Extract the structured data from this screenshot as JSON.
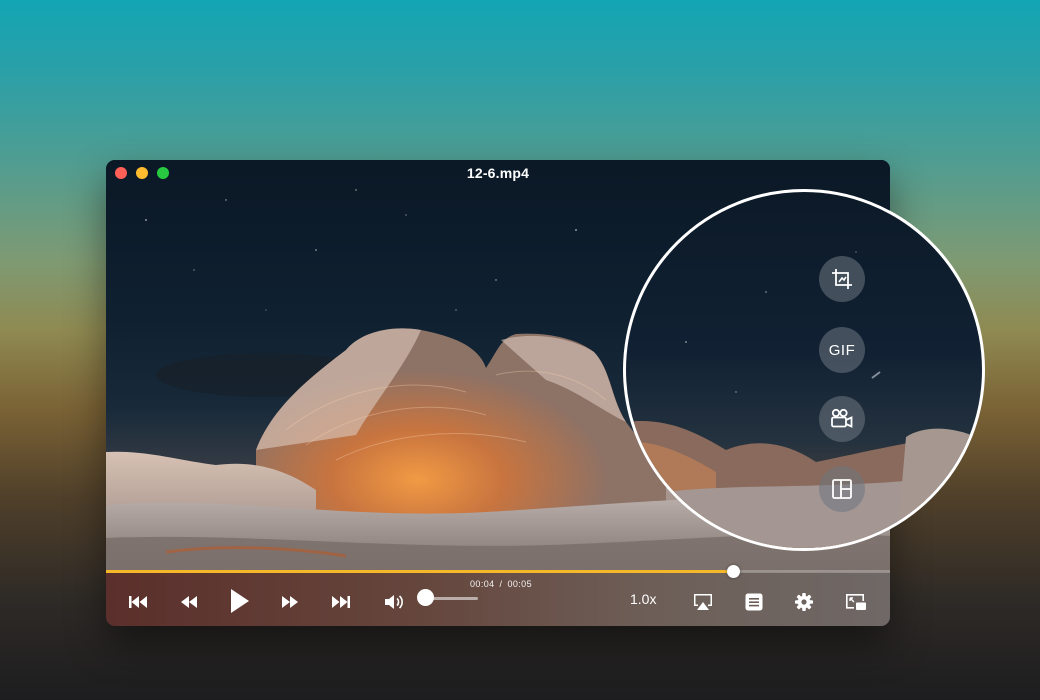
{
  "window": {
    "title": "12-6.mp4"
  },
  "player": {
    "progress_fraction": 0.8,
    "time_current": "00:04",
    "time_separator": "/",
    "time_total": "00:05",
    "volume_fraction": 0.05,
    "speed_label": "1.0x",
    "accent_color": "#f5b82a"
  },
  "controls": {
    "buttons": [
      "skip-previous-icon",
      "rewind-icon",
      "play-icon",
      "fast-forward-icon",
      "skip-next-icon",
      "volume-icon",
      "airplay-icon",
      "playlist-icon",
      "settings-icon",
      "picture-in-picture-icon"
    ]
  },
  "magnifier": {
    "buttons": [
      "crop-icon",
      "gif-button",
      "video-record-icon",
      "layout-icon"
    ],
    "gif_label": "GIF"
  }
}
